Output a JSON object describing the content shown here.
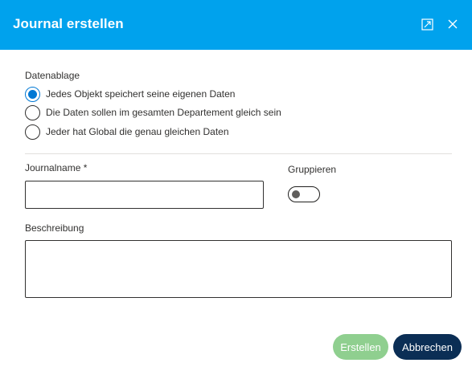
{
  "dialog": {
    "title": "Journal erstellen",
    "header_color": "#00a2ed",
    "icons": {
      "expand": "expand-icon",
      "close": "close-icon"
    }
  },
  "storage": {
    "label": "Datenablage",
    "options": [
      {
        "label": "Jedes Objekt speichert seine eigenen Daten",
        "selected": true
      },
      {
        "label": "Die Daten sollen im gesamten Departement gleich sein",
        "selected": false
      },
      {
        "label": "Jeder hat Global die genau gleichen Daten",
        "selected": false
      }
    ]
  },
  "journal_name": {
    "label": "Journalname *",
    "value": "",
    "placeholder": ""
  },
  "group": {
    "label": "Gruppieren",
    "on": false
  },
  "description": {
    "label": "Beschreibung",
    "value": "",
    "placeholder": ""
  },
  "actions": {
    "create_label": "Erstellen",
    "create_color": "#8fcf8f",
    "cancel_label": "Abbrechen",
    "cancel_color": "#0b2e55"
  }
}
